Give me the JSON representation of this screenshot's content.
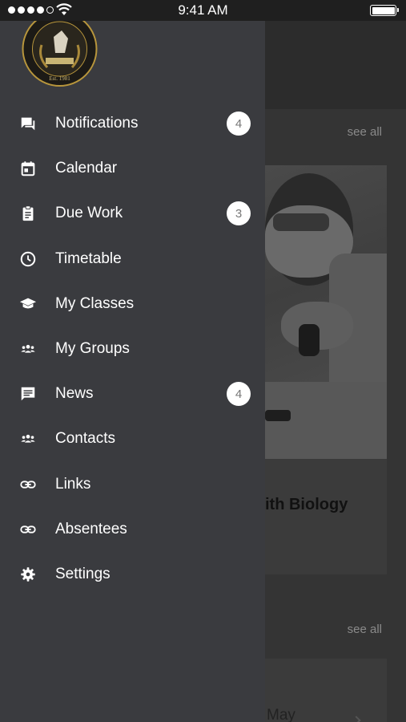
{
  "status_bar": {
    "time": "9:41 AM"
  },
  "background": {
    "see_all_1": "see all",
    "see_all_2": "see all",
    "card_title": "ith Biology",
    "card2_text": "May"
  },
  "menu": {
    "items": [
      {
        "label": "Notifications",
        "icon": "chat-icon",
        "badge": "4"
      },
      {
        "label": "Calendar",
        "icon": "calendar-icon",
        "badge": ""
      },
      {
        "label": "Due Work",
        "icon": "clipboard-icon",
        "badge": "3"
      },
      {
        "label": "Timetable",
        "icon": "clock-icon",
        "badge": ""
      },
      {
        "label": "My Classes",
        "icon": "graduation-cap-icon",
        "badge": ""
      },
      {
        "label": "My Groups",
        "icon": "group-icon",
        "badge": ""
      },
      {
        "label": "News",
        "icon": "message-icon",
        "badge": "4"
      },
      {
        "label": "Contacts",
        "icon": "group-icon",
        "badge": ""
      },
      {
        "label": "Links",
        "icon": "link-icon",
        "badge": ""
      },
      {
        "label": "Absentees",
        "icon": "link-icon",
        "badge": ""
      },
      {
        "label": "Settings",
        "icon": "gear-icon",
        "badge": ""
      }
    ]
  },
  "logo": {
    "text": "Est. 1981"
  },
  "colors": {
    "drawer": "#3a3b3f",
    "status_bar": "#1f1f1f",
    "badge": "#ffffff"
  }
}
